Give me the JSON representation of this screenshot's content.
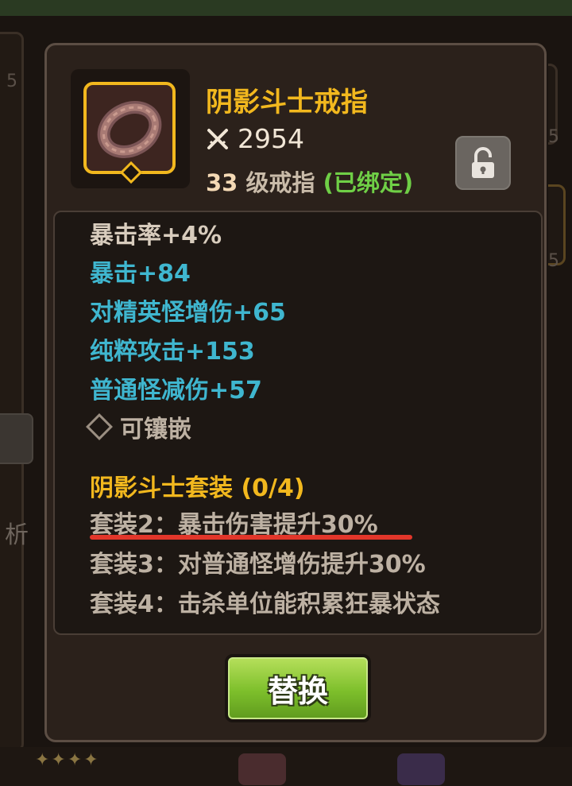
{
  "background": {
    "left_char": "析",
    "slot_numbers": [
      "5",
      "5",
      "5"
    ],
    "stars": "✦✦✦✦"
  },
  "item": {
    "name": "阴影斗士戒指",
    "power_icon": "crossed-swords-icon",
    "power": "2954",
    "level": "33",
    "type": "级戒指",
    "bound": "(已绑定)",
    "icon": "ring-icon",
    "lock_icon": "unlock-icon"
  },
  "stats": {
    "main": "暴击率+4%",
    "sub": [
      "暴击+84",
      "对精英怪增伤+65",
      "纯粹攻击+153",
      "普通怪减伤+57"
    ],
    "socket": "可镶嵌"
  },
  "set": {
    "title": "阴影斗士套装 (0/4)",
    "bonuses": [
      "套装2：暴击伤害提升30%",
      "套装3：对普通怪增伤提升30%",
      "套装4：击杀单位能积累狂暴状态"
    ]
  },
  "actions": {
    "replace": "替换"
  },
  "colors": {
    "gold": "#f2b81e",
    "blue": "#3fb6cf",
    "green": "#6fcf46",
    "red_mark": "#e2362a"
  }
}
